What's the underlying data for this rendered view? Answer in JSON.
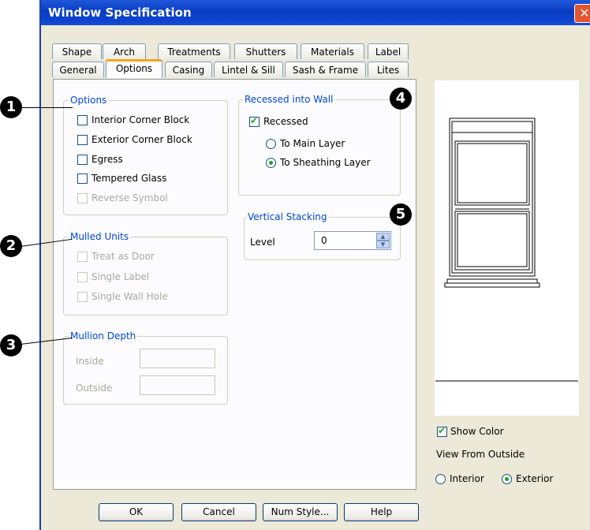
{
  "window": {
    "title": "Window Specification",
    "close_glyph": "✕"
  },
  "tabs_row1": [
    "Shape",
    "Arch",
    "Treatments",
    "Shutters",
    "Materials",
    "Label"
  ],
  "tabs_row2": [
    "General",
    "Options",
    "Casing",
    "Lintel & Sill",
    "Sash & Frame",
    "Lites"
  ],
  "active_tab": "Options",
  "options_group": {
    "legend": "Options",
    "items": [
      {
        "label": "Interior Corner Block",
        "checked": false,
        "enabled": true
      },
      {
        "label": "Exterior Corner Block",
        "checked": false,
        "enabled": true
      },
      {
        "label": "Egress",
        "checked": false,
        "enabled": true
      },
      {
        "label": "Tempered Glass",
        "checked": false,
        "enabled": true
      },
      {
        "label": "Reverse Symbol",
        "checked": false,
        "enabled": false
      }
    ]
  },
  "mulled_group": {
    "legend": "Mulled Units",
    "items": [
      {
        "label": "Treat as Door",
        "checked": false,
        "enabled": false
      },
      {
        "label": "Single Label",
        "checked": false,
        "enabled": false
      },
      {
        "label": "Single Wall Hole",
        "checked": false,
        "enabled": false
      }
    ]
  },
  "mullion_group": {
    "legend": "Mullion Depth",
    "inside_label": "Inside",
    "inside_value": "",
    "outside_label": "Outside",
    "outside_value": ""
  },
  "recessed_group": {
    "legend": "Recessed into Wall",
    "recessed_label": "Recessed",
    "recessed_checked": true,
    "radio_main": "To Main Layer",
    "radio_sheathing": "To Sheathing Layer",
    "selected": "To Sheathing Layer"
  },
  "stacking_group": {
    "legend": "Vertical Stacking",
    "level_label": "Level",
    "level_value": "0"
  },
  "preview": {
    "show_color_label": "Show Color",
    "show_color_checked": true,
    "view_from_label": "View From Outside",
    "radio_interior": "Interior",
    "radio_exterior": "Exterior",
    "selected": "Exterior"
  },
  "buttons": {
    "ok": "OK",
    "cancel": "Cancel",
    "num_style": "Num Style...",
    "help": "Help"
  },
  "callouts": [
    "1",
    "2",
    "3",
    "4",
    "5"
  ],
  "colors": {
    "title_bar": "#0a3cc4",
    "legend_text": "#0046d5",
    "check": "#21a121",
    "active_tab_accent": "#f7a31c"
  }
}
